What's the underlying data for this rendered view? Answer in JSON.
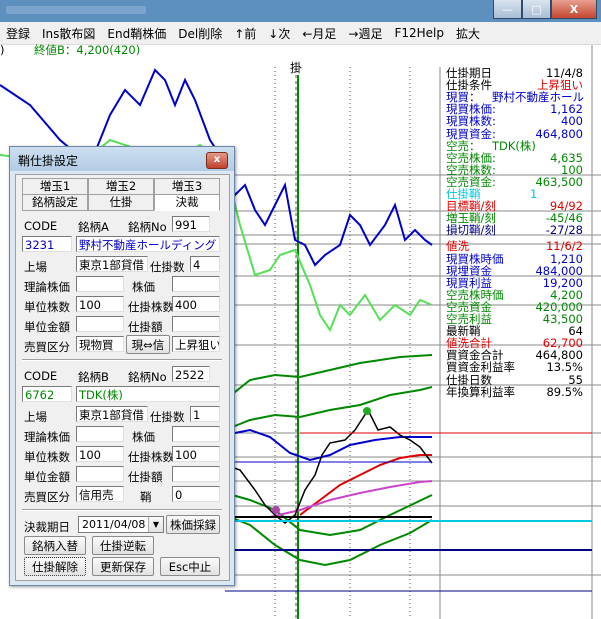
{
  "menu": [
    "登録",
    "Ins散布図",
    "End鞘株価",
    "Del削除",
    "↑前",
    "↓次",
    "←月足",
    "→週足",
    "F12Help",
    "拡大"
  ],
  "window_buttons": {
    "minimize": "—",
    "maximize": "□",
    "close": "X"
  },
  "chart": {
    "price_label": "終値B：4,200(420)",
    "marker": "掛",
    "partial_label": ")"
  },
  "right_panel": [
    {
      "label": "仕掛期日",
      "value": "11/4/8",
      "color": "#000000"
    },
    {
      "label": "仕掛条件",
      "value": "上昇狙い",
      "color": "#000000",
      "value_color": "#e00000"
    },
    {
      "label": "現買：",
      "value": "野村不動産ホール",
      "color": "#0000cc"
    },
    {
      "label": "現買株価:",
      "value": "1,162",
      "color": "#0000cc"
    },
    {
      "label": "現買株数:",
      "value": "400",
      "color": "#0000cc"
    },
    {
      "label": "現買資金:",
      "value": "464,800",
      "color": "#0000cc"
    },
    {
      "label": "空売：",
      "value": "TDK(株)",
      "color": "#008800"
    },
    {
      "label": "空売株価:",
      "value": "4,635",
      "color": "#008800"
    },
    {
      "label": "空売株数:",
      "value": "100",
      "color": "#008800"
    },
    {
      "label": "空売資金:",
      "value": "463,500",
      "color": "#008800"
    },
    {
      "label": "仕掛鞘",
      "value": "1",
      "color": "#00c8e0"
    },
    {
      "label": "目標鞘/刻",
      "value": "94/92",
      "color": "#e00000"
    },
    {
      "label": "増玉鞘/刻",
      "value": "-45/46",
      "color": "#008800"
    },
    {
      "label": "損切鞘/刻",
      "value": "-27/28",
      "color": "#000088"
    },
    {
      "label": "値洗",
      "value": "11/6/2",
      "color": "#e00000"
    },
    {
      "label": "現買株時価",
      "value": "1,210",
      "color": "#0000cc"
    },
    {
      "label": "現埋資金",
      "value": "484,000",
      "color": "#0000cc"
    },
    {
      "label": "現買利益",
      "value": "19,200",
      "color": "#0000cc"
    },
    {
      "label": "空売株時価",
      "value": "4,200",
      "color": "#008800"
    },
    {
      "label": "空売資金",
      "value": "420,000",
      "color": "#008800"
    },
    {
      "label": "空売利益",
      "value": "43,500",
      "color": "#008800"
    },
    {
      "label": "最新鞘",
      "value": "64",
      "color": "#000000"
    },
    {
      "label": "値洗合計",
      "value": "62,700",
      "color": "#e00000"
    },
    {
      "label": "買資金合計",
      "value": "464,800",
      "color": "#000000"
    },
    {
      "label": "買資金利益率",
      "value": "13.5%",
      "color": "#000000"
    },
    {
      "label": "仕掛日数",
      "value": "55",
      "color": "#000000"
    },
    {
      "label": "年換算利益率",
      "value": "89.5%",
      "color": "#000000"
    }
  ],
  "dialog": {
    "title": "鞘仕掛設定",
    "close_label": "x",
    "tabs_row1": [
      "増玉1",
      "増玉2",
      "増玉3"
    ],
    "tabs_row2": [
      "銘柄設定",
      "仕掛",
      "決裁"
    ],
    "section_a": {
      "code_label": "CODE",
      "code": "3231",
      "meigara_label": "銘柄A",
      "no_label": "銘柄No",
      "no": "991",
      "name": "野村不動産ホールディング",
      "market_label": "上場",
      "market": "東京1部貸借",
      "shikake_count_label": "仕掛数",
      "shikake_count": "4",
      "theory_price_label": "理論株価",
      "price_label": "株価",
      "unit_shares_label": "単位株数",
      "unit_shares": "100",
      "shikake_shares_label": "仕掛株数",
      "shikake_shares": "400",
      "unit_amount_label": "単位金額",
      "shikake_amount_label": "仕掛額",
      "trade_type_label": "売買区分",
      "trade_type": "現物買",
      "swap_button": "現⇔信",
      "direction": "上昇狙い"
    },
    "section_b": {
      "code_label": "CODE",
      "code": "6762",
      "meigara_label": "銘柄B",
      "no_label": "銘柄No",
      "no": "2522",
      "name": "TDK(株)",
      "market_label": "上場",
      "market": "東京1部貸借",
      "shikake_count_label": "仕掛数",
      "shikake_count": "1",
      "theory_price_label": "理論株価",
      "price_label": "株価",
      "unit_shares_label": "単位株数",
      "unit_shares": "100",
      "shikake_shares_label": "仕掛株数",
      "shikake_shares": "100",
      "unit_amount_label": "単位金額",
      "shikake_amount_label": "仕掛額",
      "trade_type_label": "売買区分",
      "trade_type": "信用売",
      "saya_label": "鞘",
      "saya": "0"
    },
    "settle_date_label": "決裁期日",
    "settle_date": "2011/04/08",
    "price_adopt_button": "株価採録",
    "swap_stocks_button": "銘柄入替",
    "reverse_button": "仕掛逆転",
    "release_button": "仕掛解除",
    "save_button": "更新保存",
    "cancel_button": "Esc中止"
  }
}
